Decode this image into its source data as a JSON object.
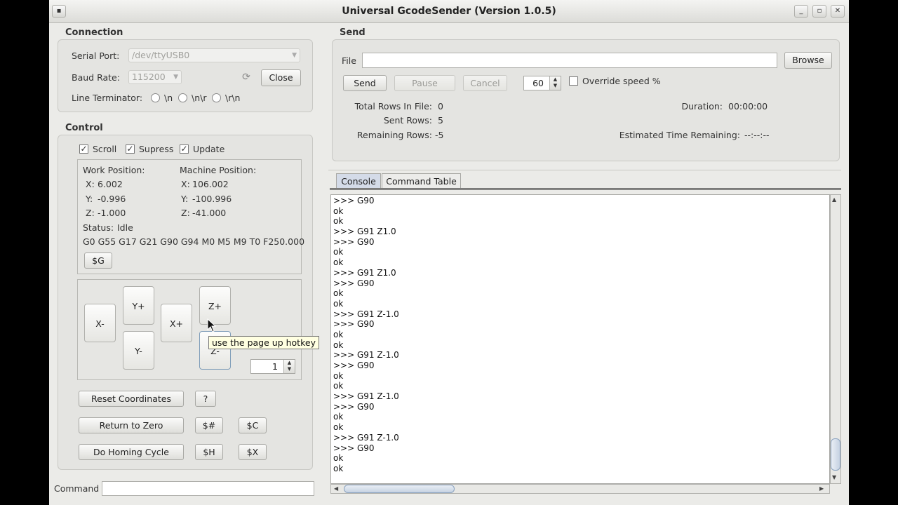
{
  "window": {
    "title": "Universal GcodeSender (Version 1.0.5)",
    "menu_icon": "window-menu-icon"
  },
  "connection": {
    "heading": "Connection",
    "serial_port_label": "Serial Port:",
    "serial_port_value": "/dev/ttyUSB0",
    "baud_rate_label": "Baud Rate:",
    "baud_rate_value": "115200",
    "close_label": "Close",
    "line_terminator_label": "Line Terminator:",
    "terminators": [
      "\\n",
      "\\n\\r",
      "\\r\\n"
    ]
  },
  "control": {
    "heading": "Control",
    "checkboxes": [
      {
        "label": "Scroll",
        "checked": true
      },
      {
        "label": "Supress",
        "checked": true
      },
      {
        "label": "Update",
        "checked": true
      }
    ],
    "work_position_label": "Work Position:",
    "machine_position_label": "Machine Position:",
    "work": {
      "x_label": "X:",
      "x": "6.002",
      "y_label": "Y:",
      "y": "-0.996",
      "z_label": "Z:",
      "z": "-1.000"
    },
    "machine": {
      "x_label": "X:",
      "x": "106.002",
      "y_label": "Y:",
      "y": "-100.996",
      "z_label": "Z:",
      "z": "-41.000"
    },
    "status_label": "Status:",
    "status_value": "Idle",
    "gcode_state": "G0 G55 G17 G21 G90 G94 M0 M5 M9 T0 F250.000",
    "g_button": "$G",
    "jog": {
      "x_minus": "X-",
      "x_plus": "X+",
      "y_plus": "Y+",
      "y_minus": "Y-",
      "z_plus": "Z+",
      "z_minus": "Z-"
    },
    "step_size_value": "1",
    "tooltip": "use the page up hotkey",
    "buttons": {
      "reset_coordinates": "Reset Coordinates",
      "help": "?",
      "return_to_zero": "Return to Zero",
      "hash": "$#",
      "c": "$C",
      "homing": "Do Homing Cycle",
      "h": "$H",
      "x": "$X"
    },
    "command_label": "Command"
  },
  "send": {
    "heading": "Send",
    "file_label": "File",
    "file_value": "",
    "browse_label": "Browse",
    "send_label": "Send",
    "pause_label": "Pause",
    "cancel_label": "Cancel",
    "speed_value": "60",
    "override_label": "Override speed %",
    "override_checked": false,
    "total_rows_label": "Total Rows In File:",
    "total_rows": "0",
    "sent_rows_label": "Sent Rows:",
    "sent_rows": "5",
    "remaining_rows_label": "Remaining Rows:",
    "remaining_rows": "-5",
    "duration_label": "Duration:",
    "duration": "00:00:00",
    "eta_label": "Estimated Time Remaining:",
    "eta": "--:--:--"
  },
  "tabs": [
    {
      "label": "Console",
      "active": true
    },
    {
      "label": "Command Table",
      "active": false
    }
  ],
  "console_lines": [
    ">>> G90",
    "ok",
    "ok",
    ">>> G91 Z1.0",
    ">>> G90",
    "ok",
    "ok",
    ">>> G91 Z1.0",
    ">>> G90",
    "ok",
    "ok",
    ">>> G91 Z-1.0",
    ">>> G90",
    "ok",
    "ok",
    ">>> G91 Z-1.0",
    ">>> G90",
    "ok",
    "ok",
    ">>> G91 Z-1.0",
    ">>> G90",
    "ok",
    "ok",
    ">>> G91 Z-1.0",
    ">>> G90",
    "ok",
    "ok"
  ]
}
